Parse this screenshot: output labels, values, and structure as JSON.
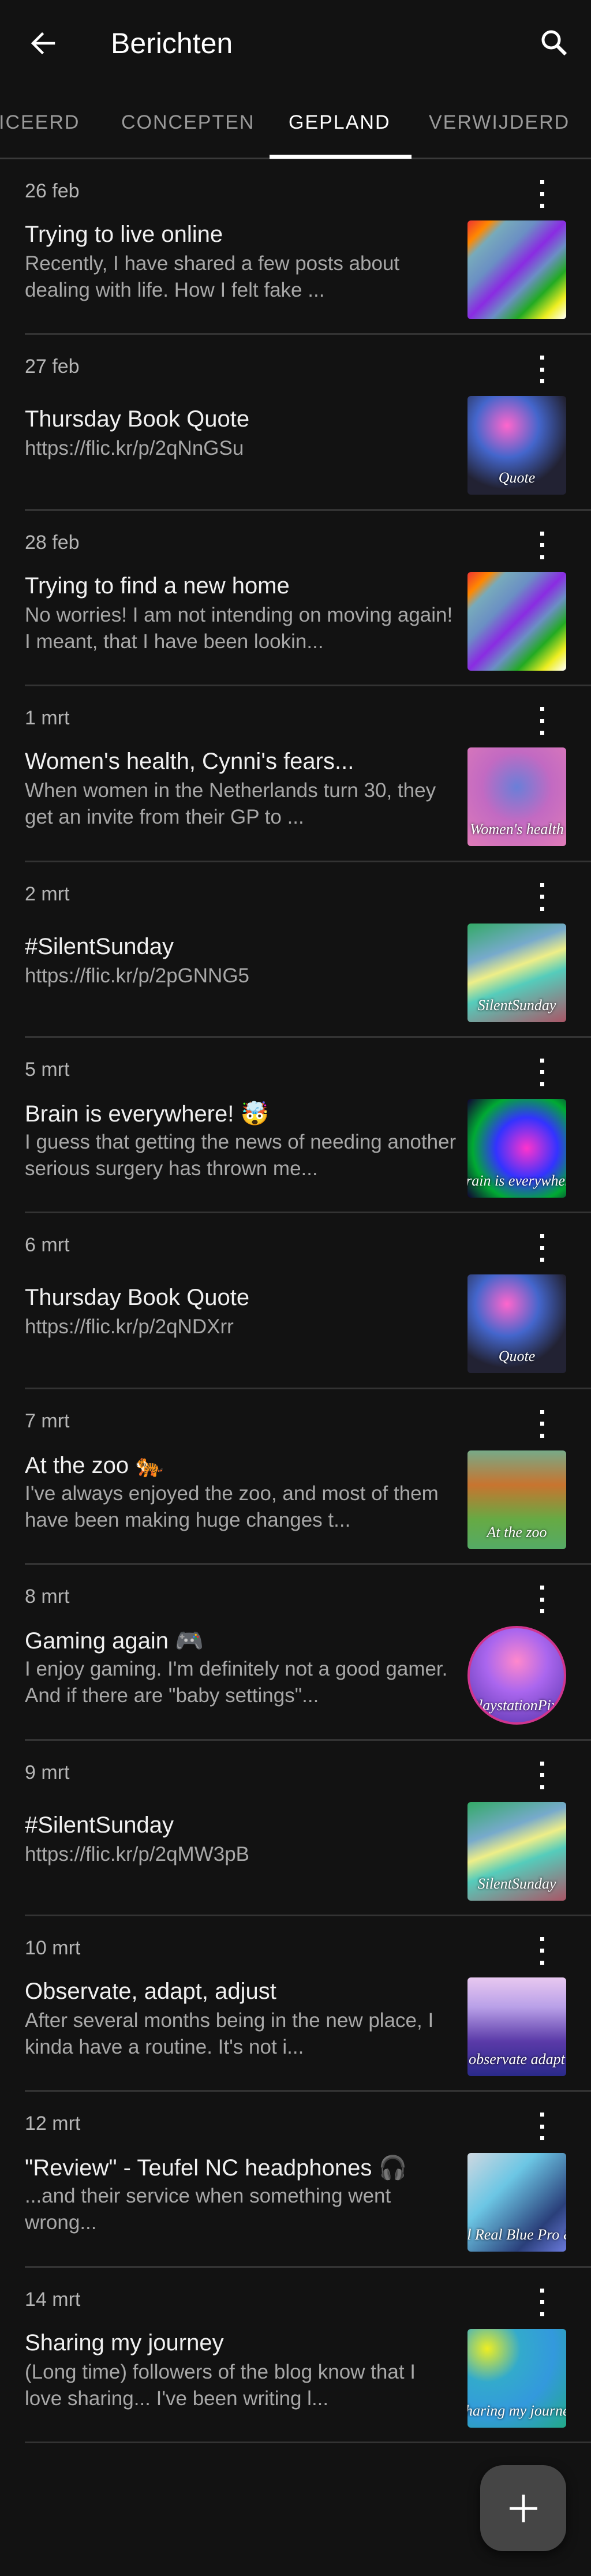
{
  "appbar": {
    "title": "Berichten",
    "back_icon": "arrow-left-icon",
    "search_icon": "search-icon"
  },
  "tabs": [
    {
      "label": "ICEERD",
      "active": false
    },
    {
      "label": "CONCEPTEN",
      "active": false
    },
    {
      "label": "GEPLAND",
      "active": true
    },
    {
      "label": "VERWIJDERD",
      "active": false
    }
  ],
  "posts": [
    {
      "date": "26 feb",
      "title": "Trying to live online",
      "excerpt": "Recently, I have shared a few posts about dealing with life. How I felt fake ...",
      "thumb_caption": ""
    },
    {
      "date": "27 feb",
      "title": "Thursday Book Quote",
      "excerpt": "https://flic.kr/p/2qNnGSu",
      "thumb_caption": "Quote"
    },
    {
      "date": "28 feb",
      "title": "Trying to find a new home",
      "excerpt": "No worries! I am not intending on moving again! I meant, that I have been lookin...",
      "thumb_caption": ""
    },
    {
      "date": "1 mrt",
      "title": "Women's health, Cynni's fears...",
      "excerpt": "When women in the Netherlands turn 30, they get an invite from their GP to ...",
      "thumb_caption": "Women's health"
    },
    {
      "date": "2 mrt",
      "title": "#SilentSunday",
      "excerpt": "https://flic.kr/p/2pGNNG5",
      "thumb_caption": "SilentSunday"
    },
    {
      "date": "5 mrt",
      "title": "Brain is everywhere! 🤯",
      "excerpt": "I guess that getting the news of needing another serious surgery has thrown me...",
      "thumb_caption": "Brain is everywhere"
    },
    {
      "date": "6 mrt",
      "title": "Thursday Book Quote",
      "excerpt": "https://flic.kr/p/2qNDXrr",
      "thumb_caption": "Quote"
    },
    {
      "date": "7 mrt",
      "title": "At the zoo 🐅",
      "excerpt": "I've always enjoyed the zoo, and most of them have been making huge changes t...",
      "thumb_caption": "At the zoo"
    },
    {
      "date": "8 mrt",
      "title": "Gaming again 🎮",
      "excerpt": "I enjoy gaming. I'm definitely not a good gamer. And if there are \"baby settings\"...",
      "thumb_caption": "PlaystationPixy"
    },
    {
      "date": "9 mrt",
      "title": "#SilentSunday",
      "excerpt": "https://flic.kr/p/2qMW3pB",
      "thumb_caption": "SilentSunday"
    },
    {
      "date": "10 mrt",
      "title": "Observate, adapt, adjust",
      "excerpt": "After several months being in the new place, I kinda have a routine. It's not i...",
      "thumb_caption": "observate adapt"
    },
    {
      "date": "12 mrt",
      "title": "\"Review\" - Teufel NC headphones 🎧",
      "excerpt": "...and their service when something went wrong...",
      "thumb_caption": "Teufel Real Blue Pro & NC"
    },
    {
      "date": "14 mrt",
      "title": "Sharing my journey",
      "excerpt": "(Long time) followers of the blog know that I love sharing... I've been writing l...",
      "thumb_caption": "Sharing my journey"
    }
  ],
  "fab": {
    "icon": "plus-icon",
    "label": "+"
  },
  "colors": {
    "background": "#121212",
    "fab": "#454545",
    "divider": "#333333",
    "tab_inactive": "#9a9a9a"
  }
}
